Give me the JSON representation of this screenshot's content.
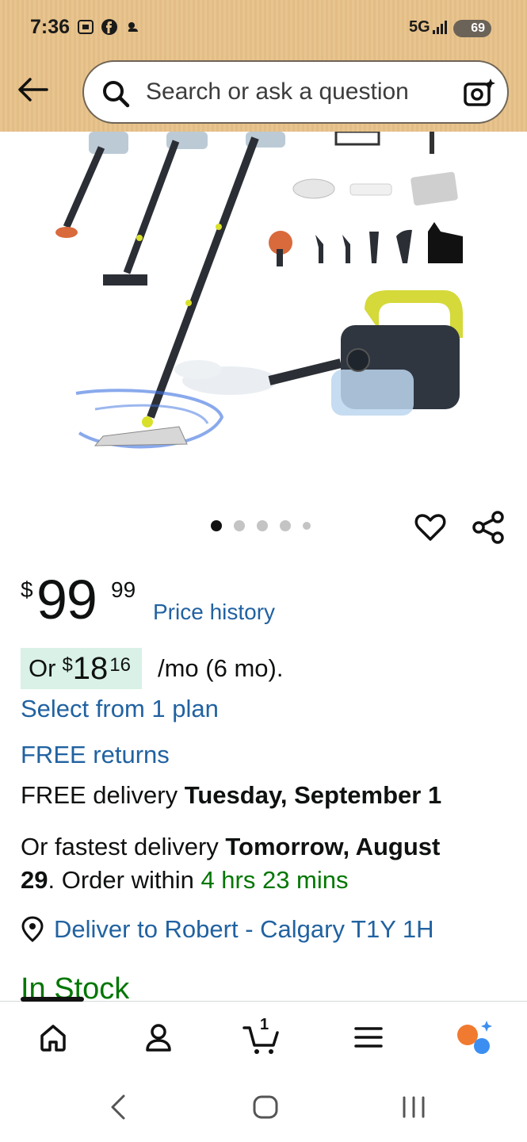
{
  "status_bar": {
    "time": "7:36",
    "network": "5G",
    "battery": "69"
  },
  "header": {
    "search_placeholder": "Search or ask a question"
  },
  "product": {
    "image_alt": "Steam cleaner with mop and accessories",
    "carousel_count": 5,
    "carousel_active": 1
  },
  "price": {
    "symbol": "$",
    "whole": "99",
    "fraction": "99",
    "history_link": "Price history"
  },
  "monthly": {
    "or_label": "Or",
    "symbol": "$",
    "whole": "18",
    "fraction": "16",
    "rest": "/mo (6 mo)."
  },
  "links": {
    "select_plan": "Select from 1 plan",
    "free_returns": "FREE returns"
  },
  "delivery": {
    "free_prefix": "FREE delivery ",
    "free_date": "Tuesday, September 1",
    "fast_prefix": "Or fastest delivery ",
    "fast_date_line1": "Tomorrow, August",
    "fast_date_line2": "29",
    "order_within_prefix": ". Order within ",
    "countdown": "4 hrs 23 mins",
    "deliver_to": "Deliver to Robert - Calgary T1Y 1H"
  },
  "stock": {
    "status": "In Stock"
  },
  "bottom_nav": {
    "cart_count": "1"
  },
  "colors": {
    "link": "#2162a1",
    "green": "#007600",
    "badge_bg": "#d9f1e6",
    "header_bg": "#e8c48e"
  }
}
